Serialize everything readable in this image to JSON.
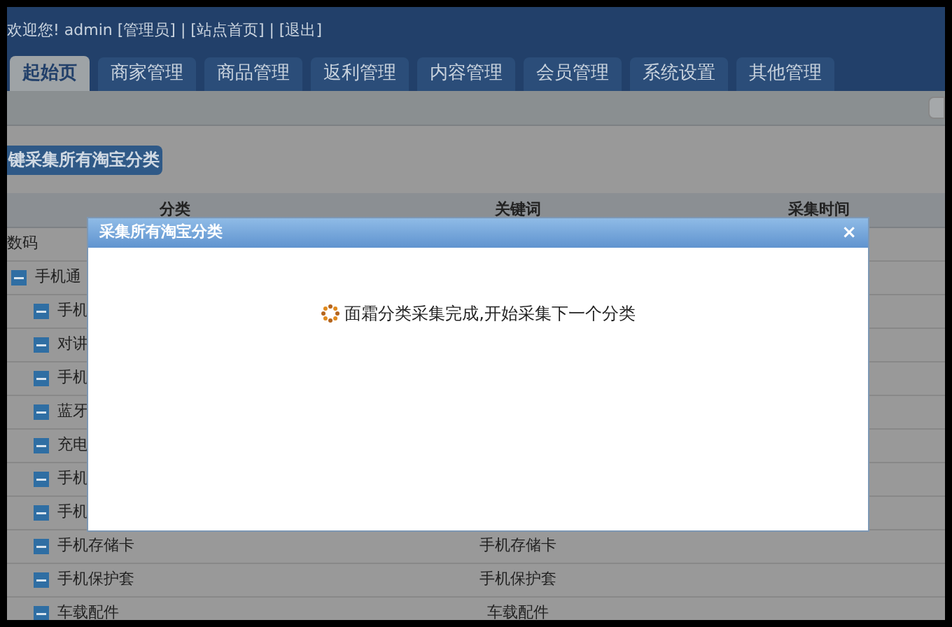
{
  "header": {
    "welcome": "欢迎您! admin [管理员] | [站点首页] | [退出]"
  },
  "tabs": [
    {
      "label": "起始页",
      "selected": true
    },
    {
      "label": "商家管理",
      "selected": false
    },
    {
      "label": "商品管理",
      "selected": false
    },
    {
      "label": "返利管理",
      "selected": false
    },
    {
      "label": "内容管理",
      "selected": false
    },
    {
      "label": "会员管理",
      "selected": false
    },
    {
      "label": "系统设置",
      "selected": false
    },
    {
      "label": "其他管理",
      "selected": false
    }
  ],
  "action_button": "键采集所有淘宝分类",
  "table": {
    "columns": [
      "分类",
      "关键词",
      "采集时间"
    ],
    "rows": [
      {
        "name": "数码",
        "children": [
          {
            "name": "手机通",
            "children": [
              {
                "name": "手机"
              },
              {
                "name": "对讲"
              },
              {
                "name": "手机"
              },
              {
                "name": "蓝牙"
              },
              {
                "name": "充电"
              },
              {
                "name": "手机"
              },
              {
                "name": "手机"
              },
              {
                "name": "手机存储卡",
                "keyword": "手机存储卡"
              },
              {
                "name": "手机保护套",
                "keyword": "手机保护套"
              },
              {
                "name": "车载配件",
                "keyword": "车载配件"
              }
            ]
          }
        ]
      }
    ]
  },
  "dialog": {
    "title": "采集所有淘宝分类",
    "close": "×",
    "message": "面霜分类采集完成,开始采集下一个分类"
  }
}
